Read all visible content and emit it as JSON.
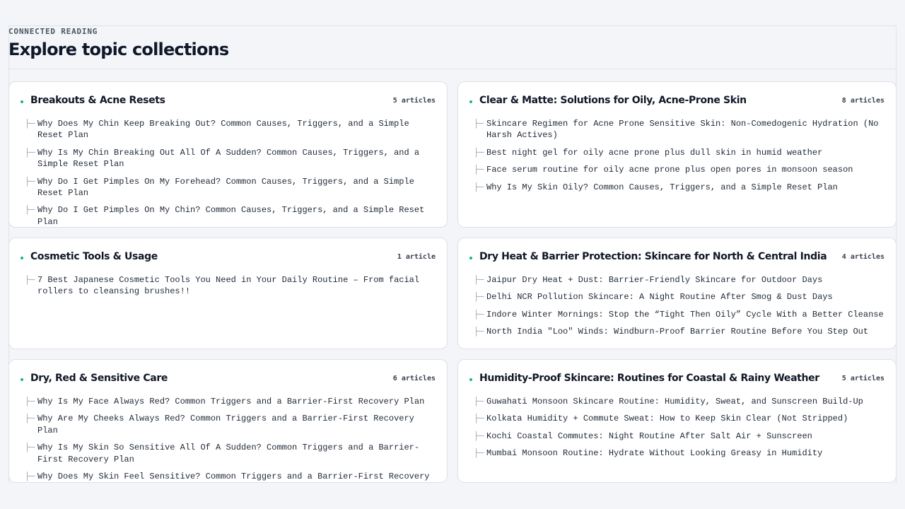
{
  "header": {
    "eyebrow": "CONNECTED READING",
    "title": "Explore topic collections"
  },
  "cards": [
    {
      "title": "Breakouts & Acne Resets",
      "count": "5 articles",
      "articles": [
        "Why Does My Chin Keep Breaking Out? Common Causes, Triggers, and a Simple Reset Plan",
        "Why Is My Chin Breaking Out All Of A Sudden? Common Causes, Triggers, and a Simple Reset Plan",
        "Why Do I Get Pimples On My Forehead? Common Causes, Triggers, and a Simple Reset Plan",
        "Why Do I Get Pimples On My Chin? Common Causes, Triggers, and a Simple Reset Plan"
      ]
    },
    {
      "title": "Clear & Matte: Solutions for Oily, Acne-Prone Skin",
      "count": "8 articles",
      "articles": [
        "Skincare Regimen for Acne Prone Sensitive Skin: Non-Comedogenic Hydration (No Harsh Actives)",
        "Best night gel for oily acne prone plus dull skin in humid weather",
        "Face serum routine for oily acne prone plus open pores in monsoon season",
        "Why Is My Skin Oily? Common Causes, Triggers, and a Simple Reset Plan"
      ]
    },
    {
      "title": "Cosmetic Tools & Usage",
      "count": "1 article",
      "articles": [
        "7 Best Japanese Cosmetic Tools You Need in Your Daily Routine – From facial rollers to cleansing brushes!!"
      ]
    },
    {
      "title": "Dry Heat & Barrier Protection: Skincare for North & Central India",
      "count": "4 articles",
      "articles": [
        "Jaipur Dry Heat + Dust: Barrier-Friendly Skincare for Outdoor Days",
        "Delhi NCR Pollution Skincare: A Night Routine After Smog & Dust Days",
        "Indore Winter Mornings: Stop the “Tight Then Oily” Cycle With a Better Cleanse",
        "North India \"Loo\" Winds: Windburn-Proof Barrier Routine Before You Step Out"
      ]
    },
    {
      "title": "Dry, Red & Sensitive Care",
      "count": "6 articles",
      "articles": [
        "Why Is My Face Always Red? Common Triggers and a Barrier-First Recovery Plan",
        "Why Are My Cheeks Always Red? Common Triggers and a Barrier-First Recovery Plan",
        "Why Is My Skin So Sensitive All Of A Sudden? Common Triggers and a Barrier-First Recovery Plan",
        "Why Does My Skin Feel Sensitive? Common Triggers and a Barrier-First Recovery Plan"
      ]
    },
    {
      "title": "Humidity-Proof Skincare: Routines for Coastal & Rainy Weather",
      "count": "5 articles",
      "articles": [
        "Guwahati Monsoon Skincare Routine: Humidity, Sweat, and Sunscreen Build-Up",
        "Kolkata Humidity + Commute Sweat: How to Keep Skin Clear (Not Stripped)",
        "Kochi Coastal Commutes: Night Routine After Salt Air + Sunscreen",
        "Mumbai Monsoon Routine: Hydrate Without Looking Greasy in Humidity"
      ]
    }
  ],
  "branch_glyph": "├─",
  "colors": {
    "accent_dot": "#10b981",
    "page_bg": "#f3f5f8",
    "card_bg": "#ffffff"
  }
}
